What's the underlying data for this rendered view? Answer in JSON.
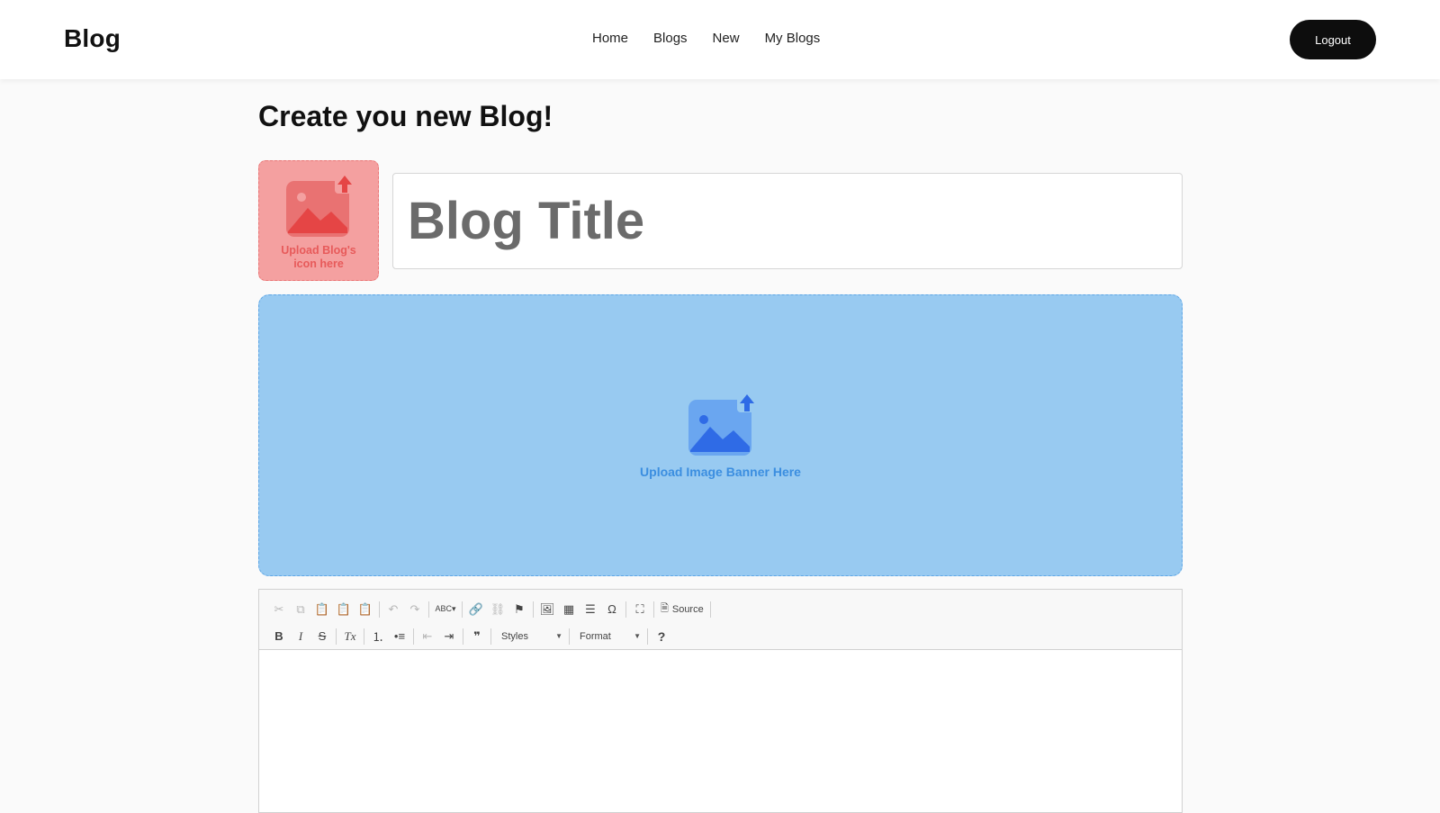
{
  "nav": {
    "brand": "Blog",
    "links": [
      "Home",
      "Blogs",
      "New",
      "My Blogs"
    ],
    "logout_label": "Logout"
  },
  "page": {
    "title": "Create you new Blog!"
  },
  "icon_upload": {
    "label": "Upload Blog's icon here",
    "icon": "image-upload-icon",
    "color": "#f4a0a0"
  },
  "title_input": {
    "placeholder": "Blog Title",
    "value": ""
  },
  "banner_upload": {
    "label": "Upload Image Banner Here",
    "icon": "image-upload-icon",
    "color": "#98caf1"
  },
  "editor": {
    "toolbar": {
      "source_label": "Source",
      "styles_label": "Styles",
      "format_label": "Format",
      "help_label": "?",
      "bold": "B",
      "italic": "I",
      "strike": "S",
      "remove_format": "Tx",
      "blockquote": "❞",
      "special_char": "Ω"
    },
    "content": ""
  },
  "colors": {
    "nav_bg": "#ffffff",
    "logout_bg": "#0d0d0d",
    "icon_label": "#e75a5a",
    "banner_label": "#3b8ee0"
  }
}
